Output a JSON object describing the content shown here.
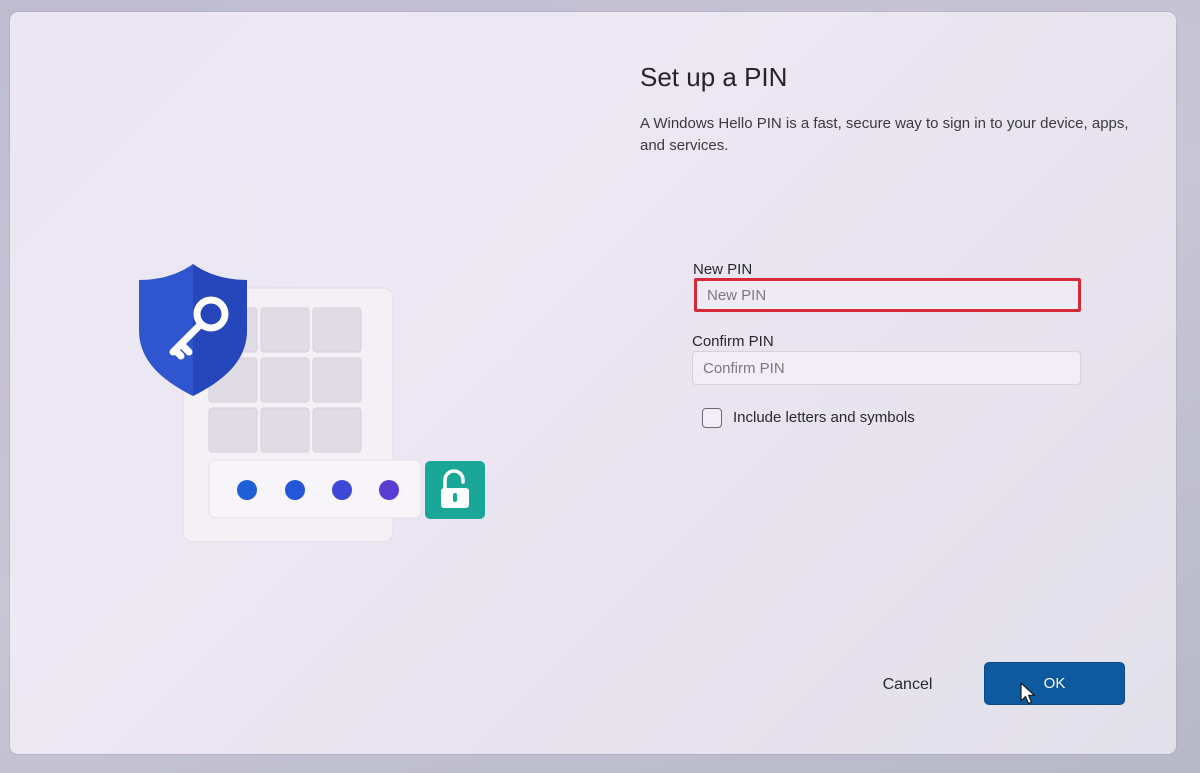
{
  "dialog": {
    "title": "Set up a PIN",
    "description": "A Windows Hello PIN is a fast, secure way to sign in to your device, apps, and services."
  },
  "new_pin": {
    "label": "New PIN",
    "placeholder": "New PIN",
    "highlight_color": "#d6293a"
  },
  "confirm_pin": {
    "label": "Confirm PIN",
    "placeholder": "Confirm PIN"
  },
  "include_letters": {
    "label": "Include letters and symbols",
    "checked": false
  },
  "buttons": {
    "cancel_label": "Cancel",
    "ok_label": "OK",
    "ok_color": "#0d5a9e"
  },
  "illustration": {
    "icons": [
      "shield-key-icon",
      "unlocked-padlock-icon"
    ],
    "pin_dot_colors": [
      "#1e5fd6",
      "#2456d8",
      "#3d48d6",
      "#5a3dd2"
    ],
    "shield_color": "#2f55cf",
    "lock_color": "#1aa797"
  },
  "colors": {
    "accent": "#0d5a9e",
    "background": "#ebe6f2"
  }
}
